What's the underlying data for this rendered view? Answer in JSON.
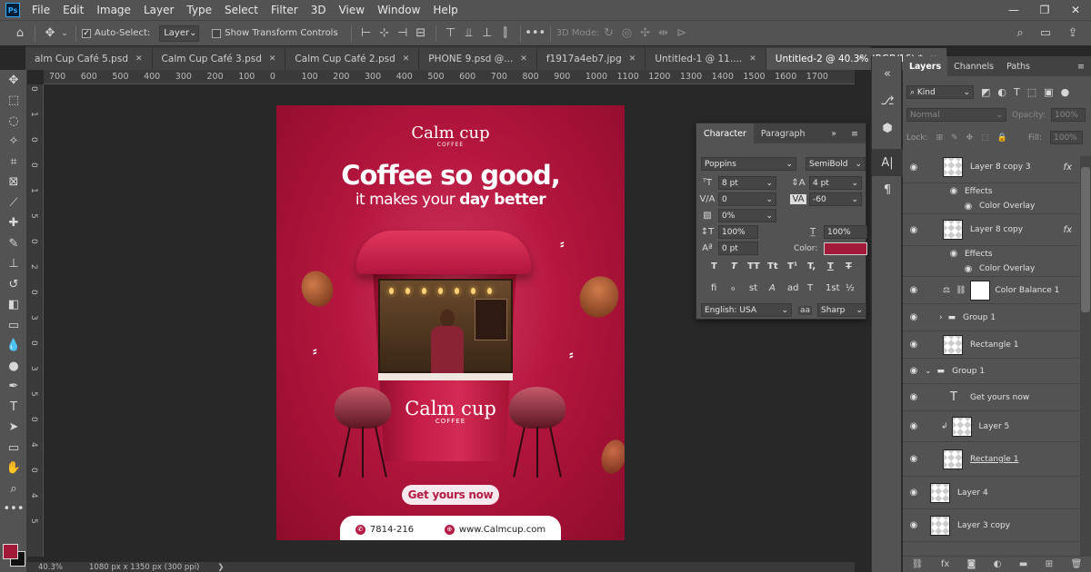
{
  "app": {
    "logo": "Ps"
  },
  "menu": [
    "File",
    "Edit",
    "Image",
    "Layer",
    "Type",
    "Select",
    "Filter",
    "3D",
    "View",
    "Window",
    "Help"
  ],
  "window_controls": {
    "minimize": "—",
    "restore": "❐",
    "close": "✕"
  },
  "options": {
    "auto_select_label": "Auto-Select:",
    "auto_select_value": "Layer",
    "transform_label": "Show Transform Controls",
    "mode_label": "3D Mode:",
    "more": "•••"
  },
  "tabs": [
    {
      "label": "alm Cup Café 5.psd",
      "close": "✕"
    },
    {
      "label": "Calm Cup Café 3.psd",
      "close": "✕"
    },
    {
      "label": "Calm Cup Café 2.psd",
      "close": "✕"
    },
    {
      "label": "PHONE 9.psd @...",
      "close": "✕"
    },
    {
      "label": "f1917a4eb7.jpg",
      "close": "✕"
    },
    {
      "label": "Untitled-1 @ 11....",
      "close": "✕"
    },
    {
      "label": "Untitled-2 @ 40.3% (RGB/16) *",
      "close": "✕"
    }
  ],
  "ruler_top": [
    "700",
    "600",
    "500",
    "400",
    "300",
    "200",
    "100",
    "0",
    "100",
    "200",
    "300",
    "400",
    "500",
    "600",
    "700",
    "800",
    "900",
    "1000",
    "1100",
    "1200",
    "1300",
    "1400",
    "1500",
    "1600",
    "1700"
  ],
  "ruler_left": [
    "0",
    "1",
    "0",
    "0",
    "1",
    "5",
    "0",
    "2",
    "0",
    "3",
    "0",
    "3",
    "5",
    "0",
    "4",
    "0",
    "4",
    "5"
  ],
  "poster": {
    "brand": "Calm cup",
    "brand_sub": "COFFEE",
    "headline1": "Coffee so good,",
    "headline2_pre": "it makes your ",
    "headline2_bold": "day better",
    "cup_brand": "Calm cup",
    "cup_sub": "COFFEE",
    "cta": "Get yours now",
    "phone": "7814-216",
    "website": "www.Calmcup.com",
    "phone_icon": "phone-icon",
    "web_icon": "globe-icon"
  },
  "status": {
    "zoom": "40.3%",
    "doc_info": "1080 px x 1350 px (300 ppi)",
    "arrow": "❯"
  },
  "character": {
    "tab_character": "Character",
    "tab_paragraph": "Paragraph",
    "font": "Poppins",
    "style": "SemiBold",
    "size": "8 pt",
    "leading": "4 pt",
    "kerning": "0",
    "tracking": "-60",
    "vscale_pct": "0%",
    "vscale": "100%",
    "hscale": "100%",
    "baseline": "0 pt",
    "color_label": "Color:",
    "color": "#a31a38",
    "language": "English: USA",
    "aa_label": "aa",
    "antialias": "Sharp",
    "type_buttons": [
      "T",
      "T",
      "TT",
      "Tt",
      "T¹",
      "T,",
      "T",
      "T"
    ],
    "ot_buttons": [
      "fi",
      "ℴ",
      "st",
      "A",
      "ad",
      "T",
      "1st",
      "½"
    ]
  },
  "layers_panel": {
    "tabs": [
      "Layers",
      "Channels",
      "Paths"
    ],
    "kind": "Kind",
    "blend": "Normal",
    "opacity_label": "Opacity:",
    "opacity": "100%",
    "lock_label": "Lock:",
    "fill_label": "Fill:",
    "fill": "100%",
    "layers": [
      {
        "name": "Layer 8 copy 3",
        "fx": "fx"
      },
      {
        "name": "Effects"
      },
      {
        "name": "Color Overlay"
      },
      {
        "name": "Layer 8 copy",
        "fx": "fx"
      },
      {
        "name": "Effects"
      },
      {
        "name": "Color Overlay"
      },
      {
        "name": "Color Balance 1"
      },
      {
        "name": "Group 1"
      },
      {
        "name": "Rectangle 1"
      },
      {
        "name": "Group 1"
      },
      {
        "name": "Get yours now"
      },
      {
        "name": "Layer 5"
      },
      {
        "name": "Rectangle 1"
      },
      {
        "name": "Layer 4"
      },
      {
        "name": "Layer 3 copy"
      }
    ]
  }
}
